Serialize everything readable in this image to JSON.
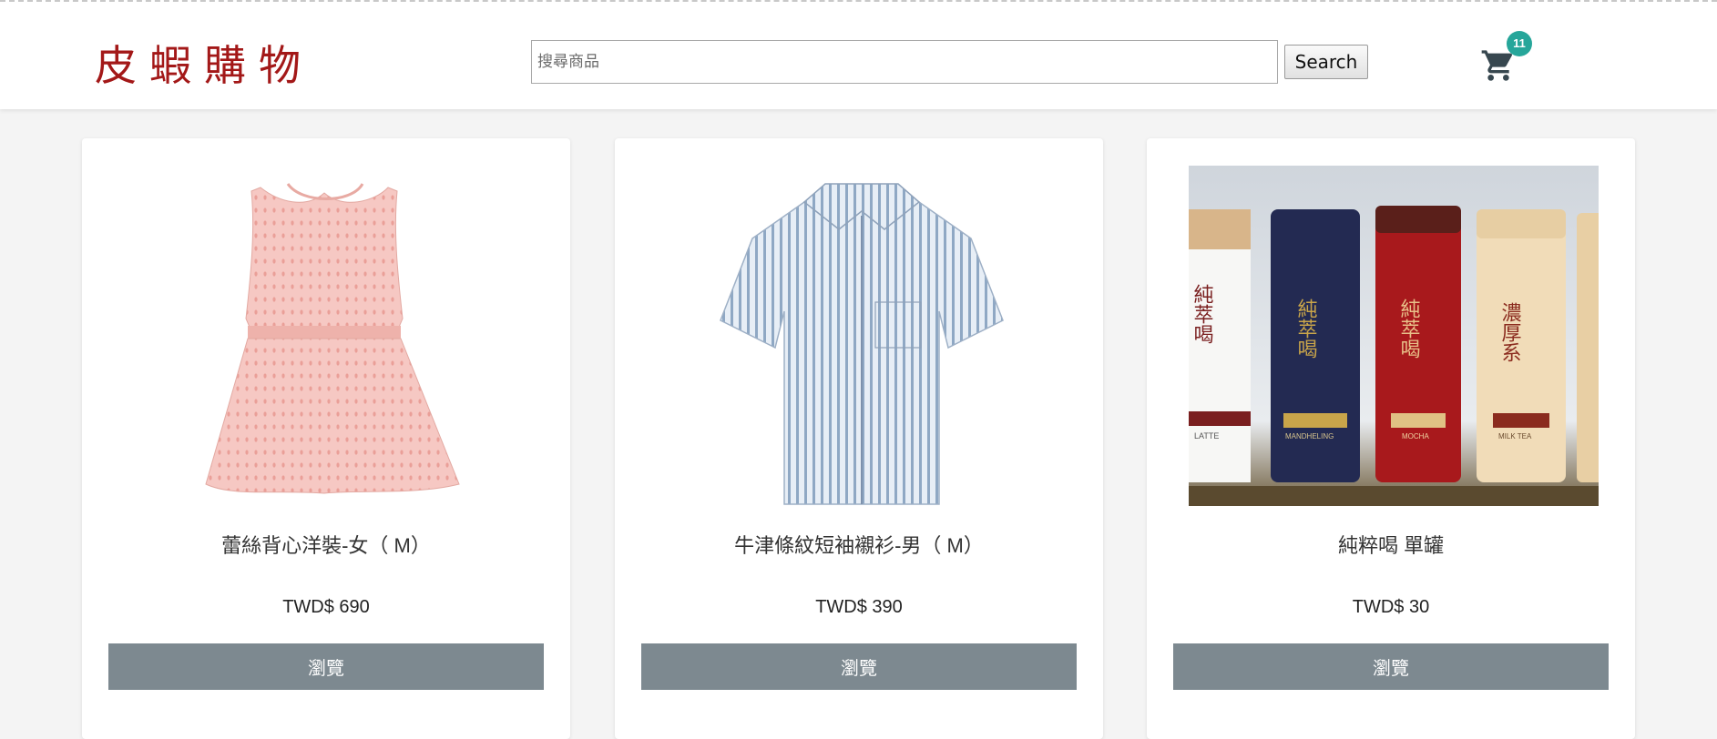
{
  "header": {
    "logo_text": "皮蝦購物",
    "search": {
      "placeholder": "搜尋商品",
      "value": ""
    },
    "search_button_label": "Search",
    "cart": {
      "count": "11",
      "badge_color": "#26a69a",
      "icon": "shopping-cart-icon"
    }
  },
  "products": [
    {
      "title": "蕾絲背心洋裝-女（ M）",
      "price": "TWD$ 690",
      "button_label": "瀏覽"
    },
    {
      "title": "牛津條紋短袖襯衫-男（ M）",
      "price": "TWD$ 390",
      "button_label": "瀏覽"
    },
    {
      "title": "純粹喝 單罐",
      "price": "TWD$ 30",
      "button_label": "瀏覽",
      "bottle_labels": [
        {
          "main": "純萃喝",
          "sub": "LATTE"
        },
        {
          "main": "純萃喝",
          "sub": "MANDHELING"
        },
        {
          "main": "純萃喝",
          "sub": "MOCHA"
        },
        {
          "main": "濃厚系",
          "sub": "MILK TEA"
        }
      ]
    }
  ],
  "colors": {
    "logo": "#a31818",
    "button_bg": "#7d8990",
    "page_bg": "#f4f4f4"
  }
}
